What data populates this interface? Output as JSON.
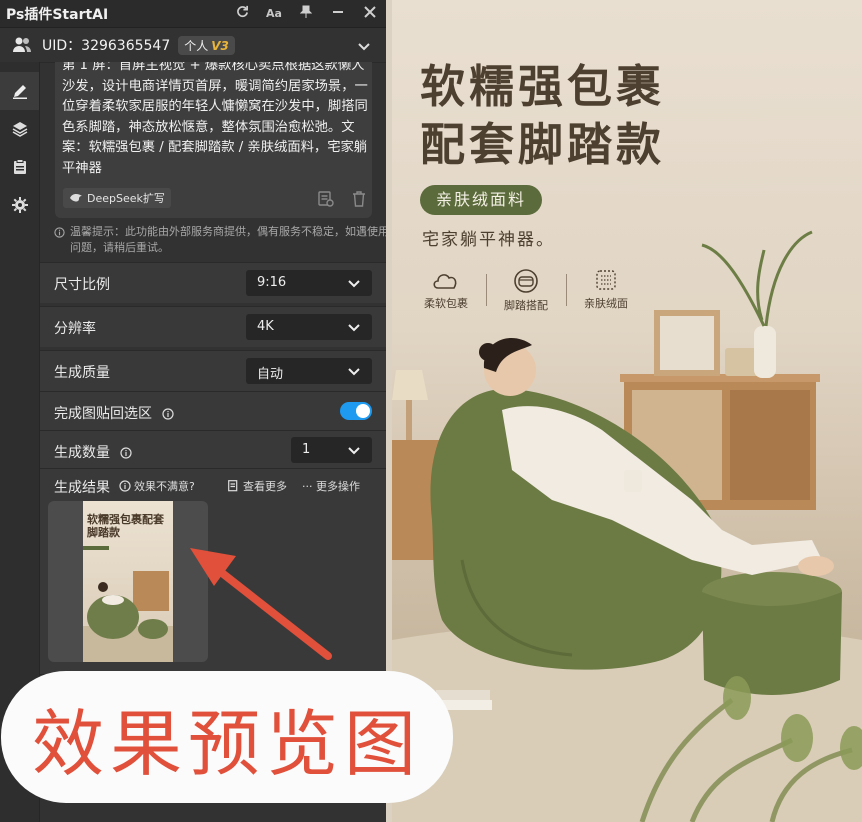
{
  "titlebar": {
    "title": "Ps插件StartAI",
    "icons": [
      "refresh-icon",
      "font-size-icon",
      "pin-icon",
      "minimize-icon",
      "close-icon"
    ],
    "font_label": "Aa"
  },
  "user": {
    "uid_label": "UID：3296365547",
    "tier_label": "个人",
    "tier_badge": "V3"
  },
  "rail": {
    "items": [
      "edit-icon",
      "layers-icon",
      "clipboard-icon",
      "gear-icon"
    ]
  },
  "prompt": {
    "text": "第 1 屏：首屏主视觉 + 爆款核心卖点根据这款懒人沙发，设计电商详情页首屏，暖调简约居家场景，一位穿着柔软家居服的年轻人慵懒窝在沙发中，脚搭同色系脚踏，神态放松惬意，整体氛围治愈松弛。文案：软糯强包裹 / 配套脚踏款 / 亲肤绒面料，宅家躺平神器",
    "deepseek_label": "DeepSeek扩写"
  },
  "hint": "温馨提示：此功能由外部服务商提供，偶有服务不稳定，如遇使用问题，请稍后重试。",
  "settings": {
    "aspect": {
      "label": "尺寸比例",
      "value": "9:16"
    },
    "resolution": {
      "label": "分辨率",
      "value": "4K"
    },
    "quality": {
      "label": "生成质量",
      "value": "自动"
    },
    "paste_back": {
      "label": "完成图贴回选区",
      "enabled": true
    },
    "count": {
      "label": "生成数量",
      "value": "1"
    }
  },
  "results": {
    "label": "生成结果",
    "unsatisfied": "效果不满意?",
    "view_more": "查看更多",
    "more_ops": "··· 更多操作",
    "thumb_title": "软糯强包裹配套脚踏款"
  },
  "preview": {
    "headline_1": "软糯强包裹",
    "headline_2": "配套脚踏款",
    "pill": "亲肤绒面料",
    "subline": "宅家躺平神器。",
    "features": [
      "柔软包裹",
      "脚踏搭配",
      "亲肤绒面"
    ],
    "accent_color": "#5b6b3b"
  },
  "overlay": {
    "label": "效果预览图",
    "color": "#e0503a"
  }
}
